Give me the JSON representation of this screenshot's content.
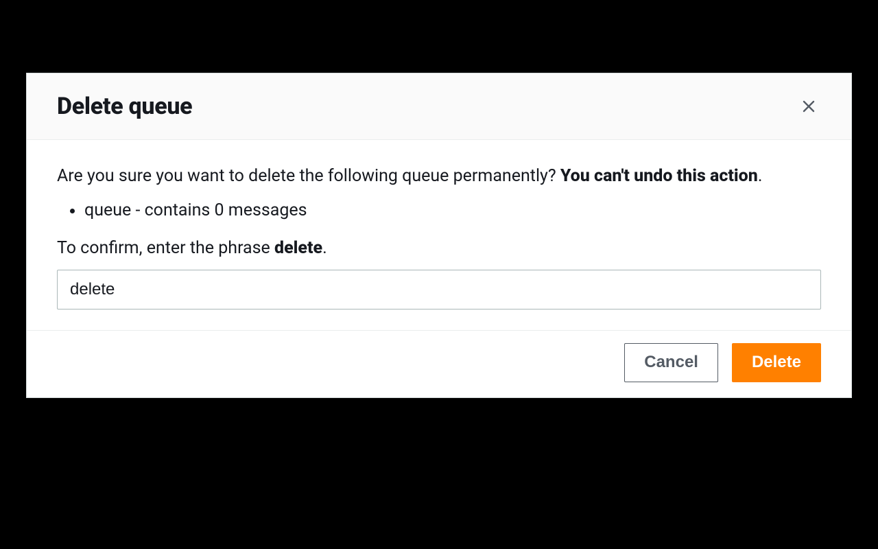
{
  "dialog": {
    "title": "Delete queue",
    "body": {
      "question": "Are you sure you want to delete the following queue permanently? ",
      "warning_bold": "You can't undo this action",
      "warning_tail": ".",
      "items": [
        "queue - contains 0 messages"
      ],
      "confirm_pre": "To confirm, enter the phrase ",
      "confirm_phrase": "delete",
      "confirm_post": ".",
      "input_value": "delete",
      "input_placeholder": "delete"
    },
    "footer": {
      "cancel_label": "Cancel",
      "delete_label": "Delete"
    }
  },
  "colors": {
    "accent": "#ff8000",
    "text": "#16191f",
    "muted": "#545b64",
    "border": "#aab7b8"
  }
}
